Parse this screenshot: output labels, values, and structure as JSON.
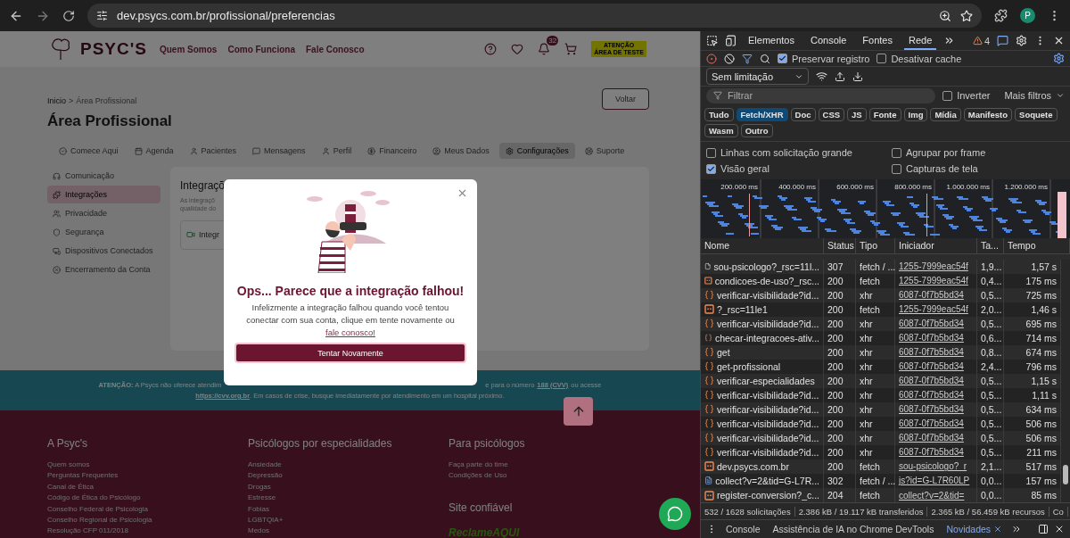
{
  "browser": {
    "url": "dev.psycs.com.br/profissional/preferencias",
    "avatar_letter": "P"
  },
  "header": {
    "logo": "PSYC'S",
    "nav": [
      "Quem Somos",
      "Como Funciona",
      "Fale Conosco"
    ],
    "notification_count": "32",
    "test_badge": [
      "ATENÇÃO",
      "ÁREA DE TESTE"
    ]
  },
  "page": {
    "breadcrumb": [
      "Inicio",
      "Área Profissional"
    ],
    "separator": ">",
    "title": "Área Profissional",
    "back_button": "Voltar"
  },
  "tabs": [
    {
      "label": "Comece Aqui",
      "selected": false
    },
    {
      "label": "Agenda",
      "selected": false
    },
    {
      "label": "Pacientes",
      "selected": false
    },
    {
      "label": "Mensagens",
      "selected": false
    },
    {
      "label": "Perfil",
      "selected": false
    },
    {
      "label": "Financeiro",
      "selected": false
    },
    {
      "label": "Meus Dados",
      "selected": false
    },
    {
      "label": "Configurações",
      "selected": true
    },
    {
      "label": "Suporte",
      "selected": false
    }
  ],
  "sidebar": [
    {
      "label": "Comunicação",
      "selected": false
    },
    {
      "label": "Integrações",
      "selected": true
    },
    {
      "label": "Privacidade",
      "selected": false
    },
    {
      "label": "Segurança",
      "selected": false
    },
    {
      "label": "Dispositivos Conectados",
      "selected": false
    },
    {
      "label": "Encerramento da Conta",
      "selected": false
    }
  ],
  "card": {
    "title": "Integraçõ",
    "description": [
      "As integraçõ",
      "qualidade do"
    ],
    "item": "Integr"
  },
  "modal": {
    "title": "Ops... Parece que a integração falhou!",
    "message": "Infelizmente a integração falhou quando você tentou conectar com sua conta, clique em tente novamente ou",
    "link": "fale conosco!",
    "button": "Tentar Novamente"
  },
  "crisis": {
    "left": "**ATENÇÃO:** A Psycs não oferece atendim",
    "right": "e para o número",
    "phone": "188 (CVV)",
    "right_end": "ou acesse",
    "url": "https://cvv.org.br",
    "rest": ". Em casos de crise, busque imediatamente por atendimento em um hospital próximo."
  },
  "footer": {
    "columns": [
      {
        "title": "A Psyc's",
        "links": [
          "Quem somos",
          "Perguntas Frequentes",
          "Canal de Ética",
          "Código de Ética do Psicólogo",
          "Conselho Federal de Psicologia",
          "Conselho Regional de Psicologia",
          "Resolução CFP 011/2018"
        ]
      },
      {
        "title": "Psicólogos por especialidades",
        "links": [
          "Ansiedade",
          "Depressão",
          "Drogas",
          "Estresse",
          "Fobias",
          "LGBTQIA+",
          "Medos"
        ]
      },
      {
        "title": "Para psicólogos",
        "links": [
          "Faça parte do time",
          "Condições de Uso"
        ]
      }
    ],
    "trusted": {
      "title": "Site confiável",
      "logo": "ReclameAQUI"
    }
  },
  "devtools": {
    "tabs": [
      {
        "label": "Elementos",
        "selected": false
      },
      {
        "label": "Console",
        "selected": false
      },
      {
        "label": "Fontes",
        "selected": false
      },
      {
        "label": "Rede",
        "selected": true
      }
    ],
    "warnings": "4",
    "preserve_log": {
      "label": "Preservar registro",
      "checked": true
    },
    "disable_cache": {
      "label": "Desativar cache",
      "checked": false
    },
    "throttle": "Sem limitação",
    "filter_placeholder": "Filtrar",
    "invert": {
      "label": "Inverter",
      "checked": false
    },
    "more_filters": "Mais filtros",
    "types": [
      {
        "label": "Tudo",
        "selected": false
      },
      {
        "label": "Fetch/XHR",
        "selected": true
      },
      {
        "label": "Doc",
        "selected": false
      },
      {
        "label": "CSS",
        "selected": false
      },
      {
        "label": "JS",
        "selected": false
      },
      {
        "label": "Fonte",
        "selected": false
      },
      {
        "label": "Img",
        "selected": false
      },
      {
        "label": "Mídia",
        "selected": false
      },
      {
        "label": "Manifesto",
        "selected": false
      },
      {
        "label": "Soquete",
        "selected": false
      },
      {
        "label": "Wasm",
        "selected": false
      },
      {
        "label": "Outro",
        "selected": false
      }
    ],
    "options": [
      {
        "label": "Linhas com solicitação grande",
        "checked": false
      },
      {
        "label": "Agrupar por frame",
        "checked": false
      },
      {
        "label": "Visão geral",
        "checked": true
      },
      {
        "label": "Capturas de tela",
        "checked": false
      }
    ],
    "overview_ticks": [
      "200.000 ms",
      "400.000 ms",
      "600.000 ms",
      "800.000 ms",
      "1.000.000 ms",
      "1.200.000 ms"
    ],
    "columns": [
      "Nome",
      "Status",
      "Tipo",
      "Iniciador",
      "Ta...",
      "Tempo"
    ],
    "rows": [
      {
        "kind": "document",
        "name": "sou-psicologo?_rsc=11l...",
        "status": "307",
        "type": "fetch / ...",
        "initiator": "1255-7999eac54f",
        "size": "1,9...",
        "time": "1,57 s"
      },
      {
        "kind": "fetch",
        "name": "condicoes-de-uso?_rsc...",
        "status": "200",
        "type": "fetch",
        "initiator": "1255-7999eac54f",
        "size": "0,4...",
        "time": "175 ms"
      },
      {
        "kind": "xhr",
        "name": "verificar-visibilidade?id...",
        "status": "200",
        "type": "xhr",
        "initiator": "6087-0f7b5bd34",
        "size": "0,5...",
        "time": "725 ms"
      },
      {
        "kind": "fetch",
        "name": "?_rsc=11le1",
        "status": "200",
        "type": "fetch",
        "initiator": "1255-7999eac54f",
        "size": "2,0...",
        "time": "1,46 s"
      },
      {
        "kind": "xhr",
        "name": "verificar-visibilidade?id...",
        "status": "200",
        "type": "xhr",
        "initiator": "6087-0f7b5bd34",
        "size": "0,5...",
        "time": "695 ms"
      },
      {
        "kind": "xhr",
        "name": "checar-integracoes-ativ...",
        "status": "200",
        "type": "xhr",
        "initiator": "6087-0f7b5bd34",
        "size": "0,6...",
        "time": "714 ms"
      },
      {
        "kind": "xhr",
        "name": "get",
        "status": "200",
        "type": "xhr",
        "initiator": "6087-0f7b5bd34",
        "size": "0,8...",
        "time": "674 ms"
      },
      {
        "kind": "xhr",
        "name": "get-profissional",
        "status": "200",
        "type": "xhr",
        "initiator": "6087-0f7b5bd34",
        "size": "2,4...",
        "time": "796 ms"
      },
      {
        "kind": "xhr",
        "name": "verificar-especialidades",
        "status": "200",
        "type": "xhr",
        "initiator": "6087-0f7b5bd34",
        "size": "0,5...",
        "time": "1,15 s"
      },
      {
        "kind": "xhr",
        "name": "verificar-visibilidade?id...",
        "status": "200",
        "type": "xhr",
        "initiator": "6087-0f7b5bd34",
        "size": "0,5...",
        "time": "1,11 s"
      },
      {
        "kind": "xhr",
        "name": "verificar-visibilidade?id...",
        "status": "200",
        "type": "xhr",
        "initiator": "6087-0f7b5bd34",
        "size": "0,5...",
        "time": "634 ms"
      },
      {
        "kind": "xhr",
        "name": "verificar-visibilidade?id...",
        "status": "200",
        "type": "xhr",
        "initiator": "6087-0f7b5bd34",
        "size": "0,5...",
        "time": "506 ms"
      },
      {
        "kind": "xhr",
        "name": "verificar-visibilidade?id...",
        "status": "200",
        "type": "xhr",
        "initiator": "6087-0f7b5bd34",
        "size": "0,5...",
        "time": "506 ms"
      },
      {
        "kind": "xhr",
        "name": "verificar-visibilidade?id...",
        "status": "200",
        "type": "xhr",
        "initiator": "6087-0f7b5bd34",
        "size": "0,5...",
        "time": "211 ms"
      },
      {
        "kind": "fetch",
        "name": "dev.psycs.com.br",
        "status": "200",
        "type": "fetch",
        "initiator": "sou-psicologo?_r",
        "size": "2,1...",
        "time": "517 ms"
      },
      {
        "kind": "ping",
        "name": "collect?v=2&tid=G-L7R...",
        "status": "302",
        "type": "fetch / ...",
        "initiator": "js?id=G-L7R60LP",
        "size": "0,0...",
        "time": "157 ms"
      },
      {
        "kind": "fetch",
        "name": "register-conversion?_c...",
        "status": "204",
        "type": "fetch",
        "initiator": "collect?v=2&tid=",
        "size": "0,0...",
        "time": "85 ms"
      }
    ],
    "status": [
      "532 / 1628 solicitações",
      "2.386 kB / 19.117 kB transferidos",
      "2.365 kB / 56.459 kB recursos",
      "Co"
    ],
    "drawer_tabs": [
      {
        "label": "Console",
        "selected": false,
        "closable": false
      },
      {
        "label": "Assistência de IA no Chrome DevTools",
        "selected": false,
        "closable": false
      },
      {
        "label": "Novidades",
        "selected": true,
        "closable": true
      }
    ]
  }
}
